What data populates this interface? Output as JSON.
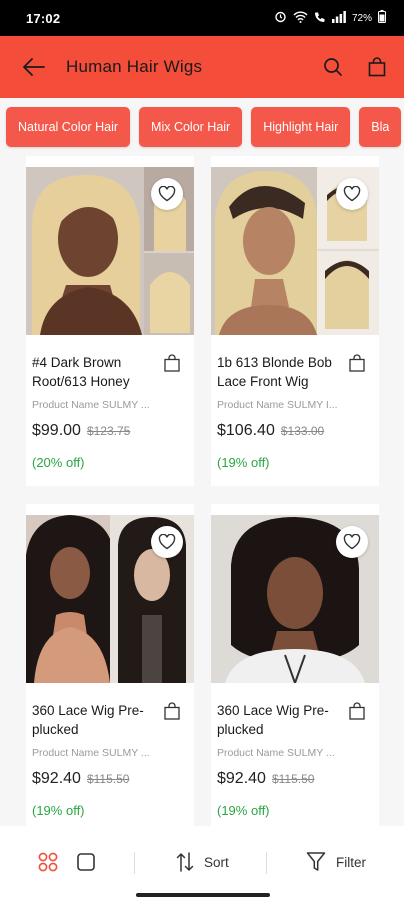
{
  "status_bar": {
    "time": "17:02",
    "battery": "72%"
  },
  "header": {
    "title": "Human Hair Wigs"
  },
  "chips": [
    "Natural Color Hair",
    "Mix Color Hair",
    "Highlight Hair",
    "Bla"
  ],
  "products": [
    {
      "title": "#4 Dark Brown Root/613 Honey",
      "subtitle": "Product Name SULMY ...",
      "price": "$99.00",
      "old_price": "$123.75",
      "discount": "(20% off)"
    },
    {
      "title": "1b 613 Blonde Bob Lace Front Wig",
      "subtitle": "Product Name SULMY I...",
      "price": "$106.40",
      "old_price": "$133.00",
      "discount": "(19% off)"
    },
    {
      "title": "360 Lace Wig Pre-plucked",
      "subtitle": "Product Name SULMY ...",
      "price": "$92.40",
      "old_price": "$115.50",
      "discount": "(19% off)"
    },
    {
      "title": "360 Lace Wig Pre-plucked",
      "subtitle": "Product Name SULMY ...",
      "price": "$92.40",
      "old_price": "$115.50",
      "discount": "(19% off)"
    }
  ],
  "bottom_bar": {
    "sort_label": "Sort",
    "filter_label": "Filter"
  },
  "colors": {
    "accent": "#f44e3b",
    "chip": "#f3584a",
    "discount": "#2aa543"
  }
}
